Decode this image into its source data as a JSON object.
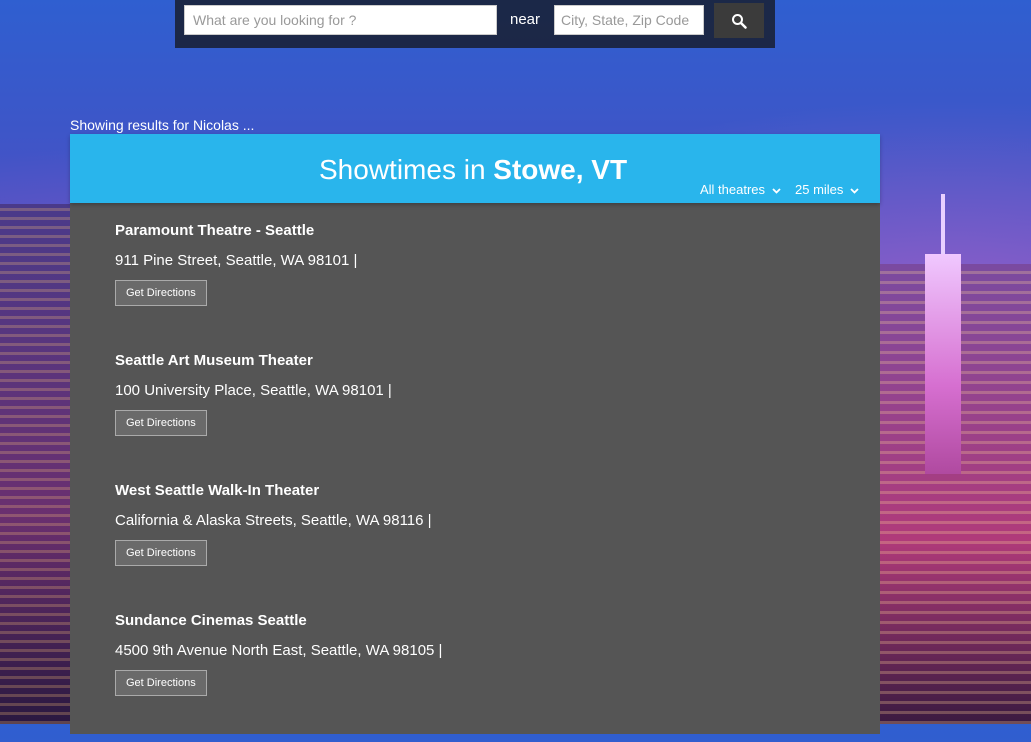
{
  "search": {
    "query_placeholder": "What are you looking for ?",
    "query_value": "",
    "near_label": "near",
    "location_placeholder": "City, State, Zip Code",
    "location_value": "",
    "button_icon": "search-icon"
  },
  "results_text": "Showing results for Nicolas ...",
  "header": {
    "title_prefix": "Showtimes in",
    "city": "Stowe, VT",
    "theatre_filter": "All theatres",
    "distance_filter": "25 miles",
    "accent_color": "#29b5ec"
  },
  "theaters": [
    {
      "name": "Paramount Theatre - Seattle",
      "address": "911 Pine Street, Seattle, WA 98101 |",
      "button": "Get Directions"
    },
    {
      "name": "Seattle Art Museum Theater",
      "address": "100 University Place, Seattle, WA 98101 |",
      "button": "Get Directions"
    },
    {
      "name": "West Seattle Walk-In Theater",
      "address": "California & Alaska Streets, Seattle, WA 98116 |",
      "button": "Get Directions"
    },
    {
      "name": "Sundance Cinemas Seattle",
      "address": "4500 9th Avenue North East, Seattle, WA 98105 |",
      "button": "Get Directions"
    }
  ]
}
